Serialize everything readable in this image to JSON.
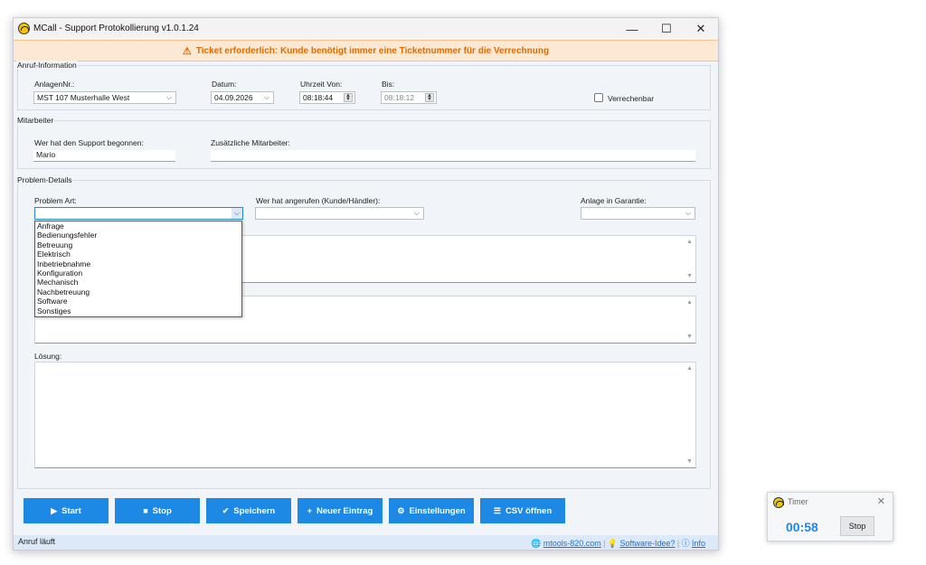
{
  "window": {
    "title": "MCall - Support Protokollierung  v1.0.1.24",
    "controls": {
      "minimize": "—",
      "maximize": "☐",
      "close": "✕"
    }
  },
  "banner": {
    "icon": "⚠",
    "text": "Ticket erforderlich: Kunde benötigt immer eine Ticketnummer für die Verrechnung"
  },
  "anruf": {
    "group_title": "Anruf-Information",
    "anlage_label": "AnlagenNr.:",
    "anlage_value": "MST 107 Musterhalle West",
    "datum_label": "Datum:",
    "datum_value": "04.09.2026",
    "von_label": "Uhrzeit Von:",
    "von_value": "08:18:44",
    "bis_label": "Bis:",
    "bis_value": "08:18:12",
    "verrechenbar_label": "Verrechenbar",
    "verrechenbar_checked": false
  },
  "mitarbeiter": {
    "group_title": "Mitarbeiter",
    "begonnen_label": "Wer hat den Support begonnen:",
    "begonnen_value": "Mario",
    "zusaetzlich_label": "Zusätzliche Mitarbeiter:",
    "zusaetzlich_value": ""
  },
  "problem": {
    "group_title": "Problem-Details",
    "art_label": "Problem Art:",
    "art_value": "",
    "angerufen_label": "Wer hat angerufen (Kunde/Händler):",
    "angerufen_value": "",
    "garantie_label": "Anlage in Garantie:",
    "garantie_value": "",
    "loesung_label": "Lösung:",
    "art_options": [
      "Anfrage",
      "Bedienungsfehler",
      "Betreuung",
      "Elektrisch",
      "Inbetriebnahme",
      "Konfiguration",
      "Mechanisch",
      "Nachbetreuung",
      "Software",
      "Sonstiges"
    ]
  },
  "buttons": [
    {
      "label": "Start",
      "icon": "▶"
    },
    {
      "label": "Stop",
      "icon": "■"
    },
    {
      "label": "Speichern",
      "icon": "✔"
    },
    {
      "label": "Neuer Eintrag",
      "icon": "+"
    },
    {
      "label": "Einstellungen",
      "icon": "⚙"
    },
    {
      "label": "CSV öffnen",
      "icon": "☰"
    }
  ],
  "status": {
    "text": "Anruf läuft",
    "website": "mtools-820.com",
    "idea": "Software-Idee?",
    "info": "Info",
    "separator": "|"
  },
  "timer": {
    "title": "Timer",
    "time": "00:58",
    "stop_label": "Stop",
    "close": "✕"
  },
  "colors": {
    "accent": "#1e88e5",
    "banner_text": "#e26a00",
    "banner_bg": "#fde9d3",
    "timer_time": "#1e88e5",
    "link": "#1e6fd9"
  }
}
